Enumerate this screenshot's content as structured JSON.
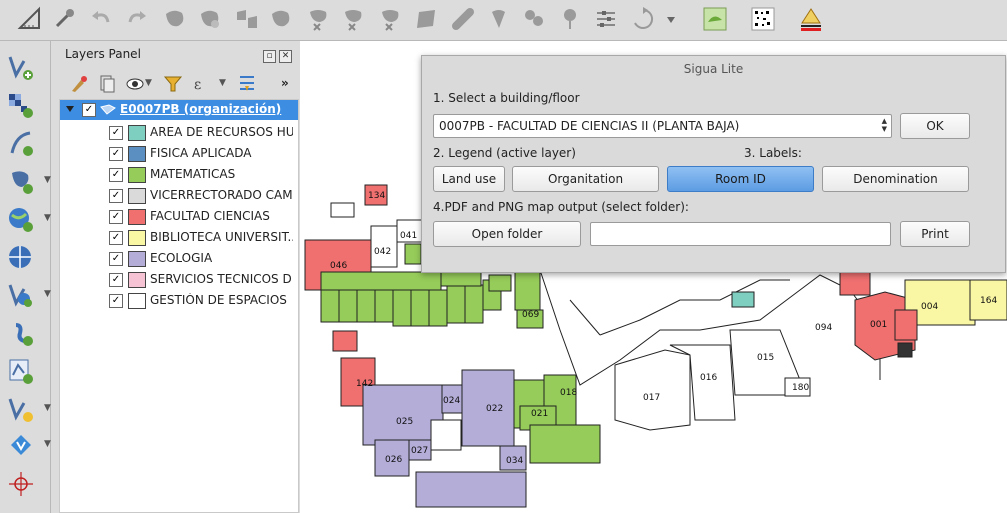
{
  "toolbar": {
    "icons": [
      "measure-icon",
      "magic-icon",
      "undo-icon",
      "redo-icon",
      "node-tool-icon",
      "rotate-icon",
      "add-part-icon",
      "move-feature-icon",
      "delete-part-icon",
      "delete-ring-icon",
      "reshape-icon",
      "fill-ring-icon",
      "split-icon",
      "split-parts-icon",
      "merge-icon",
      "offset-icon",
      "simplify-icon",
      "rotate-feature-icon",
      "more-icon",
      "plugin-green-icon",
      "plugin-qr-icon",
      "sigua-icon"
    ]
  },
  "layers_panel": {
    "title": "Layers Panel",
    "group": {
      "label": "E0007PB (organización)",
      "checked": "✓"
    },
    "layers": [
      {
        "label": "AREA DE RECURSOS HU...",
        "color": "#7ecfc0",
        "checked": "✓"
      },
      {
        "label": "FISICA APLICADA",
        "color": "#5b8fc2",
        "checked": "✓"
      },
      {
        "label": "MATEMATICAS",
        "color": "#96cc5a",
        "checked": "✓"
      },
      {
        "label": "VICERRECTORADO CAM...",
        "color": "#dadada",
        "checked": "✓"
      },
      {
        "label": "FACULTAD CIENCIAS",
        "color": "#f07070",
        "checked": "✓"
      },
      {
        "label": "BIBLIOTECA UNIVERSIT...",
        "color": "#f9f7a3",
        "checked": "✓"
      },
      {
        "label": "ECOLOGIA",
        "color": "#b3add8",
        "checked": "✓"
      },
      {
        "label": "SERVICIOS TECNICOS D...",
        "color": "#f6c3d4",
        "checked": "✓"
      },
      {
        "label": "GESTIÓN DE ESPACIOS",
        "color": "#ffffff",
        "checked": "✓"
      }
    ]
  },
  "dialog": {
    "title": "Sigua Lite",
    "step1_label": "1. Select a building/floor",
    "building_value": "0007PB - FACULTAD DE CIENCIAS II (PLANTA BAJA)",
    "ok_label": "OK",
    "legend_label": "2. Legend (active layer)",
    "labels_label": "3. Labels:",
    "land_use_label": "Land use",
    "organitation_label": "Organitation",
    "room_id_label": "Room ID",
    "denomination_label": "Denomination",
    "output_label": "4.PDF and PNG map output (select folder):",
    "open_folder_label": "Open folder",
    "folder_path": "",
    "print_label": "Print"
  },
  "map": {
    "room_labels": [
      "134",
      "041",
      "042",
      "046",
      "069",
      "142",
      "024",
      "022",
      "018",
      "021",
      "025",
      "027",
      "026",
      "034",
      "017",
      "016",
      "015",
      "094",
      "180",
      "001",
      "004",
      "164"
    ]
  }
}
